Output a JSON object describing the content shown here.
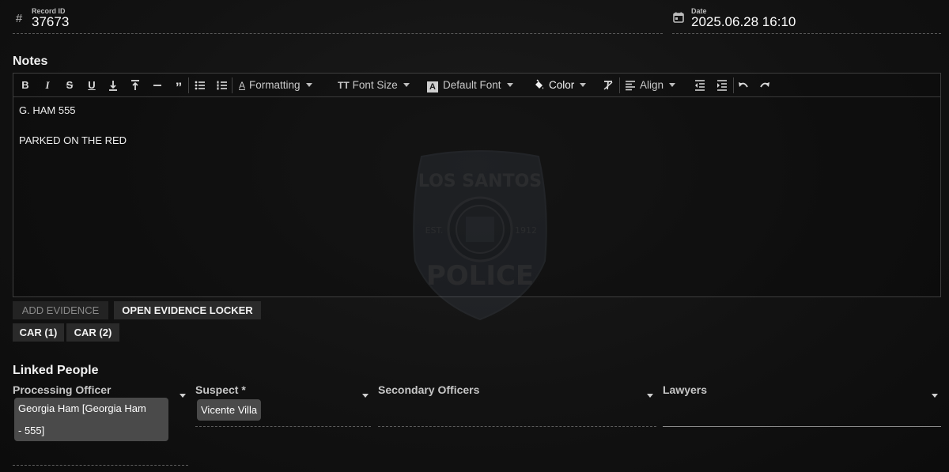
{
  "record": {
    "label": "Record ID",
    "value": "37673",
    "icon": "hash-icon"
  },
  "date": {
    "label": "Date",
    "value": "2025.06.28 16:10",
    "icon": "calendar-icon"
  },
  "notes": {
    "title": "Notes",
    "toolbar": {
      "formatting": "Formatting",
      "font_size": "Font Size",
      "default_font": "Default Font",
      "color": "Color",
      "align": "Align"
    },
    "lines": [
      "G. HAM 555",
      "PARKED ON THE RED"
    ],
    "watermark": {
      "top": "LOS SANTOS",
      "left": "EST.",
      "right": "1912",
      "bottom": "POLICE"
    }
  },
  "evidence": {
    "add_label": "ADD EVIDENCE",
    "open_locker_label": "OPEN EVIDENCE LOCKER",
    "items": [
      "CAR (1)",
      "CAR (2)"
    ]
  },
  "linked_people": {
    "title": "Linked People",
    "processing_officer": {
      "label": "Processing Officer",
      "chip_line1": "Georgia Ham [Georgia Ham",
      "chip_line2": "- 555]"
    },
    "suspect": {
      "label": "Suspect *",
      "chip": "Vicente Villa"
    },
    "secondary_officers": {
      "label": "Secondary Officers"
    },
    "lawyers": {
      "label": "Lawyers"
    }
  },
  "colors": {
    "background": "#121212",
    "accent_text": "#ffffff",
    "chip": "#4a4a4a",
    "button": "#2a2a2a"
  }
}
